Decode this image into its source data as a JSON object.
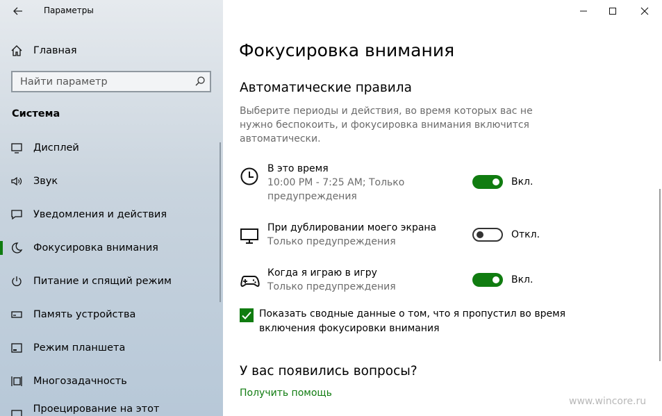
{
  "window": {
    "app_title": "Параметры",
    "controls": [
      "minimize-icon",
      "maximize-icon",
      "close-icon"
    ]
  },
  "sidebar": {
    "home_label": "Главная",
    "search_placeholder": "Найти параметр",
    "section_title": "Система",
    "items": [
      {
        "label": "Дисплей",
        "icon": "display-icon",
        "active": false
      },
      {
        "label": "Звук",
        "icon": "sound-icon",
        "active": false
      },
      {
        "label": "Уведомления и действия",
        "icon": "notifications-icon",
        "active": false
      },
      {
        "label": "Фокусировка внимания",
        "icon": "moon-icon",
        "active": true
      },
      {
        "label": "Питание и спящий режим",
        "icon": "power-icon",
        "active": false
      },
      {
        "label": "Память устройства",
        "icon": "storage-icon",
        "active": false
      },
      {
        "label": "Режим планшета",
        "icon": "tablet-icon",
        "active": false
      },
      {
        "label": "Многозадачность",
        "icon": "multitasking-icon",
        "active": false
      },
      {
        "label": "Проецирование на этот компьютер",
        "icon": "projecting-icon",
        "active": false
      }
    ]
  },
  "main": {
    "page_title": "Фокусировка внимания",
    "section_title": "Автоматические правила",
    "description": "Выберите периоды и действия, во время которых вас не нужно беспокоить, и фокусировка внимания включится автоматически.",
    "rules": [
      {
        "title": "В это время",
        "detail": "10:00 PM - 7:25 AM; Только предупреждения",
        "state": "Вкл.",
        "on": true,
        "icon": "clock-icon"
      },
      {
        "title": "При дублировании моего экрана",
        "detail": "Только предупреждения",
        "state": "Откл.",
        "on": false,
        "icon": "monitor-icon"
      },
      {
        "title": "Когда я играю в игру",
        "detail": "Только предупреждения",
        "state": "Вкл.",
        "on": true,
        "icon": "gamepad-icon"
      }
    ],
    "checkbox_label": "Показать сводные данные о том, что я пропустил во время включения фокусировки внимания",
    "checkbox_checked": true,
    "questions_title": "У вас появились вопросы?",
    "help_link": "Получить помощь"
  },
  "watermark": "www.wincore.ru",
  "colors": {
    "accent": "#107c10",
    "sidebar_bg": "#c9d4de",
    "secondary_text": "#6b6b6b"
  }
}
